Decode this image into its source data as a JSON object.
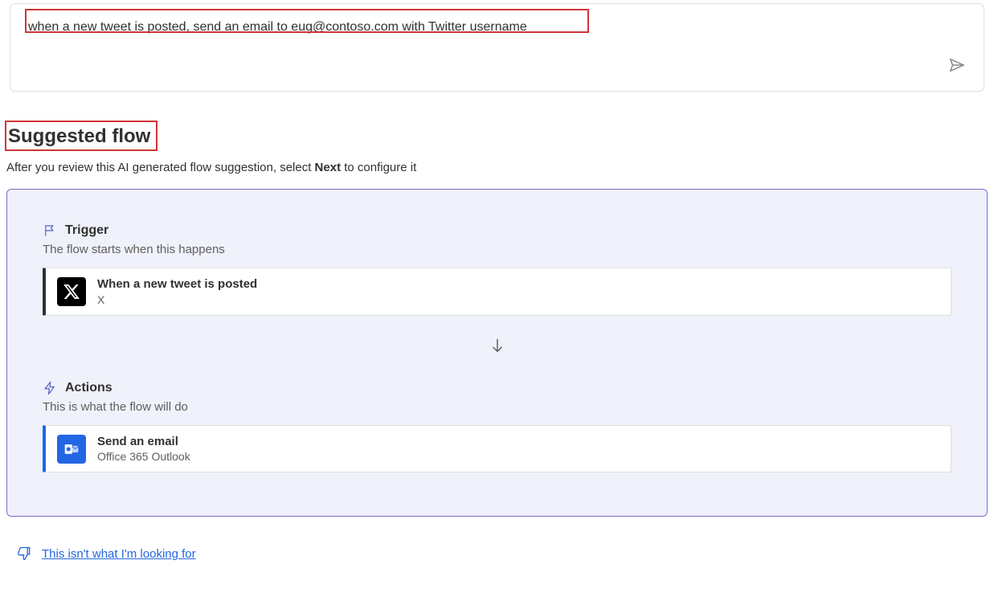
{
  "prompt": {
    "text": "when a new tweet is posted, send an email to eug@contoso.com with Twitter username"
  },
  "heading": {
    "title": "Suggested flow",
    "subtitle_before": "After you review this AI generated flow suggestion, select ",
    "subtitle_bold": "Next",
    "subtitle_after": " to configure it"
  },
  "trigger": {
    "label": "Trigger",
    "description": "The flow starts when this happens",
    "step_title": "When a new tweet is posted",
    "step_connector": "X"
  },
  "actions": {
    "label": "Actions",
    "description": "This is what the flow will do",
    "step_title": "Send an email",
    "step_connector": "Office 365 Outlook"
  },
  "feedback": {
    "link_text": "This isn't what I'm looking for"
  }
}
